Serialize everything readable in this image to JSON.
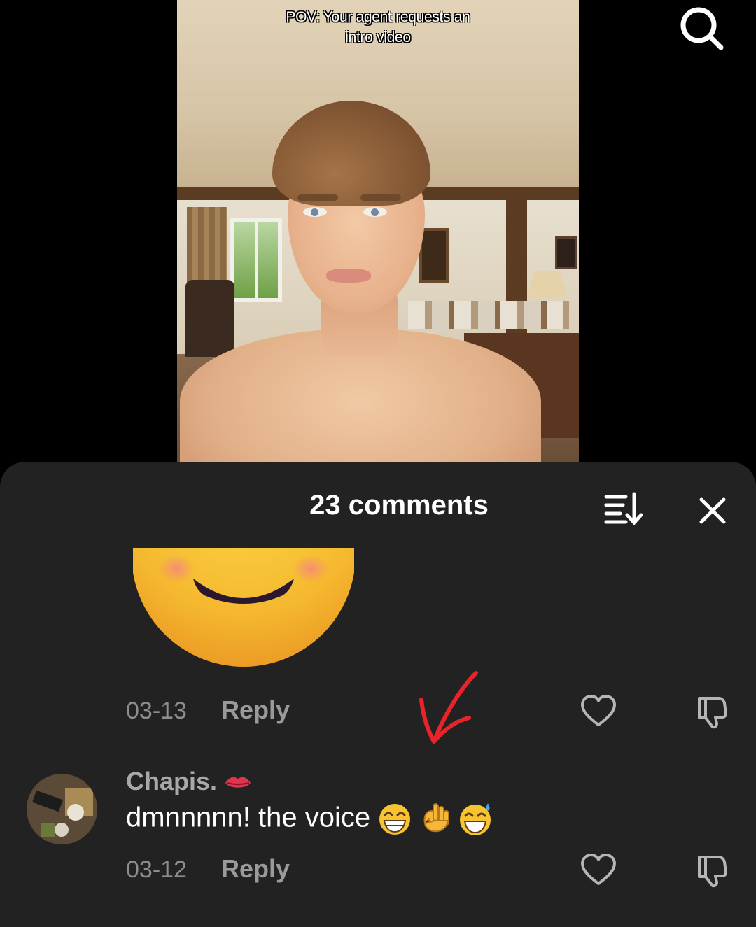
{
  "video": {
    "caption_line1": "POV: Your agent requests an",
    "caption_line2": "intro video"
  },
  "header": {
    "search_icon": "search-icon"
  },
  "comments_sheet": {
    "title": "23 comments",
    "sort_icon": "sort-icon",
    "close_icon": "close-icon",
    "comments": [
      {
        "content_type": "sticker",
        "sticker": "smiling-face-sticker",
        "date": "03-13",
        "reply_label": "Reply",
        "like_icon": "heart-icon",
        "dislike_icon": "dislike-icon"
      },
      {
        "username": "Chapis.",
        "username_emoji": "lips",
        "text": "dmnnnnn! the voice",
        "text_emojis": [
          "grinning-face",
          "ok-hand",
          "grinning-sweat"
        ],
        "date": "03-12",
        "reply_label": "Reply",
        "like_icon": "heart-icon",
        "dislike_icon": "dislike-icon"
      }
    ]
  },
  "annotation": {
    "mark": "red-checkmark",
    "color": "#e8232a"
  }
}
